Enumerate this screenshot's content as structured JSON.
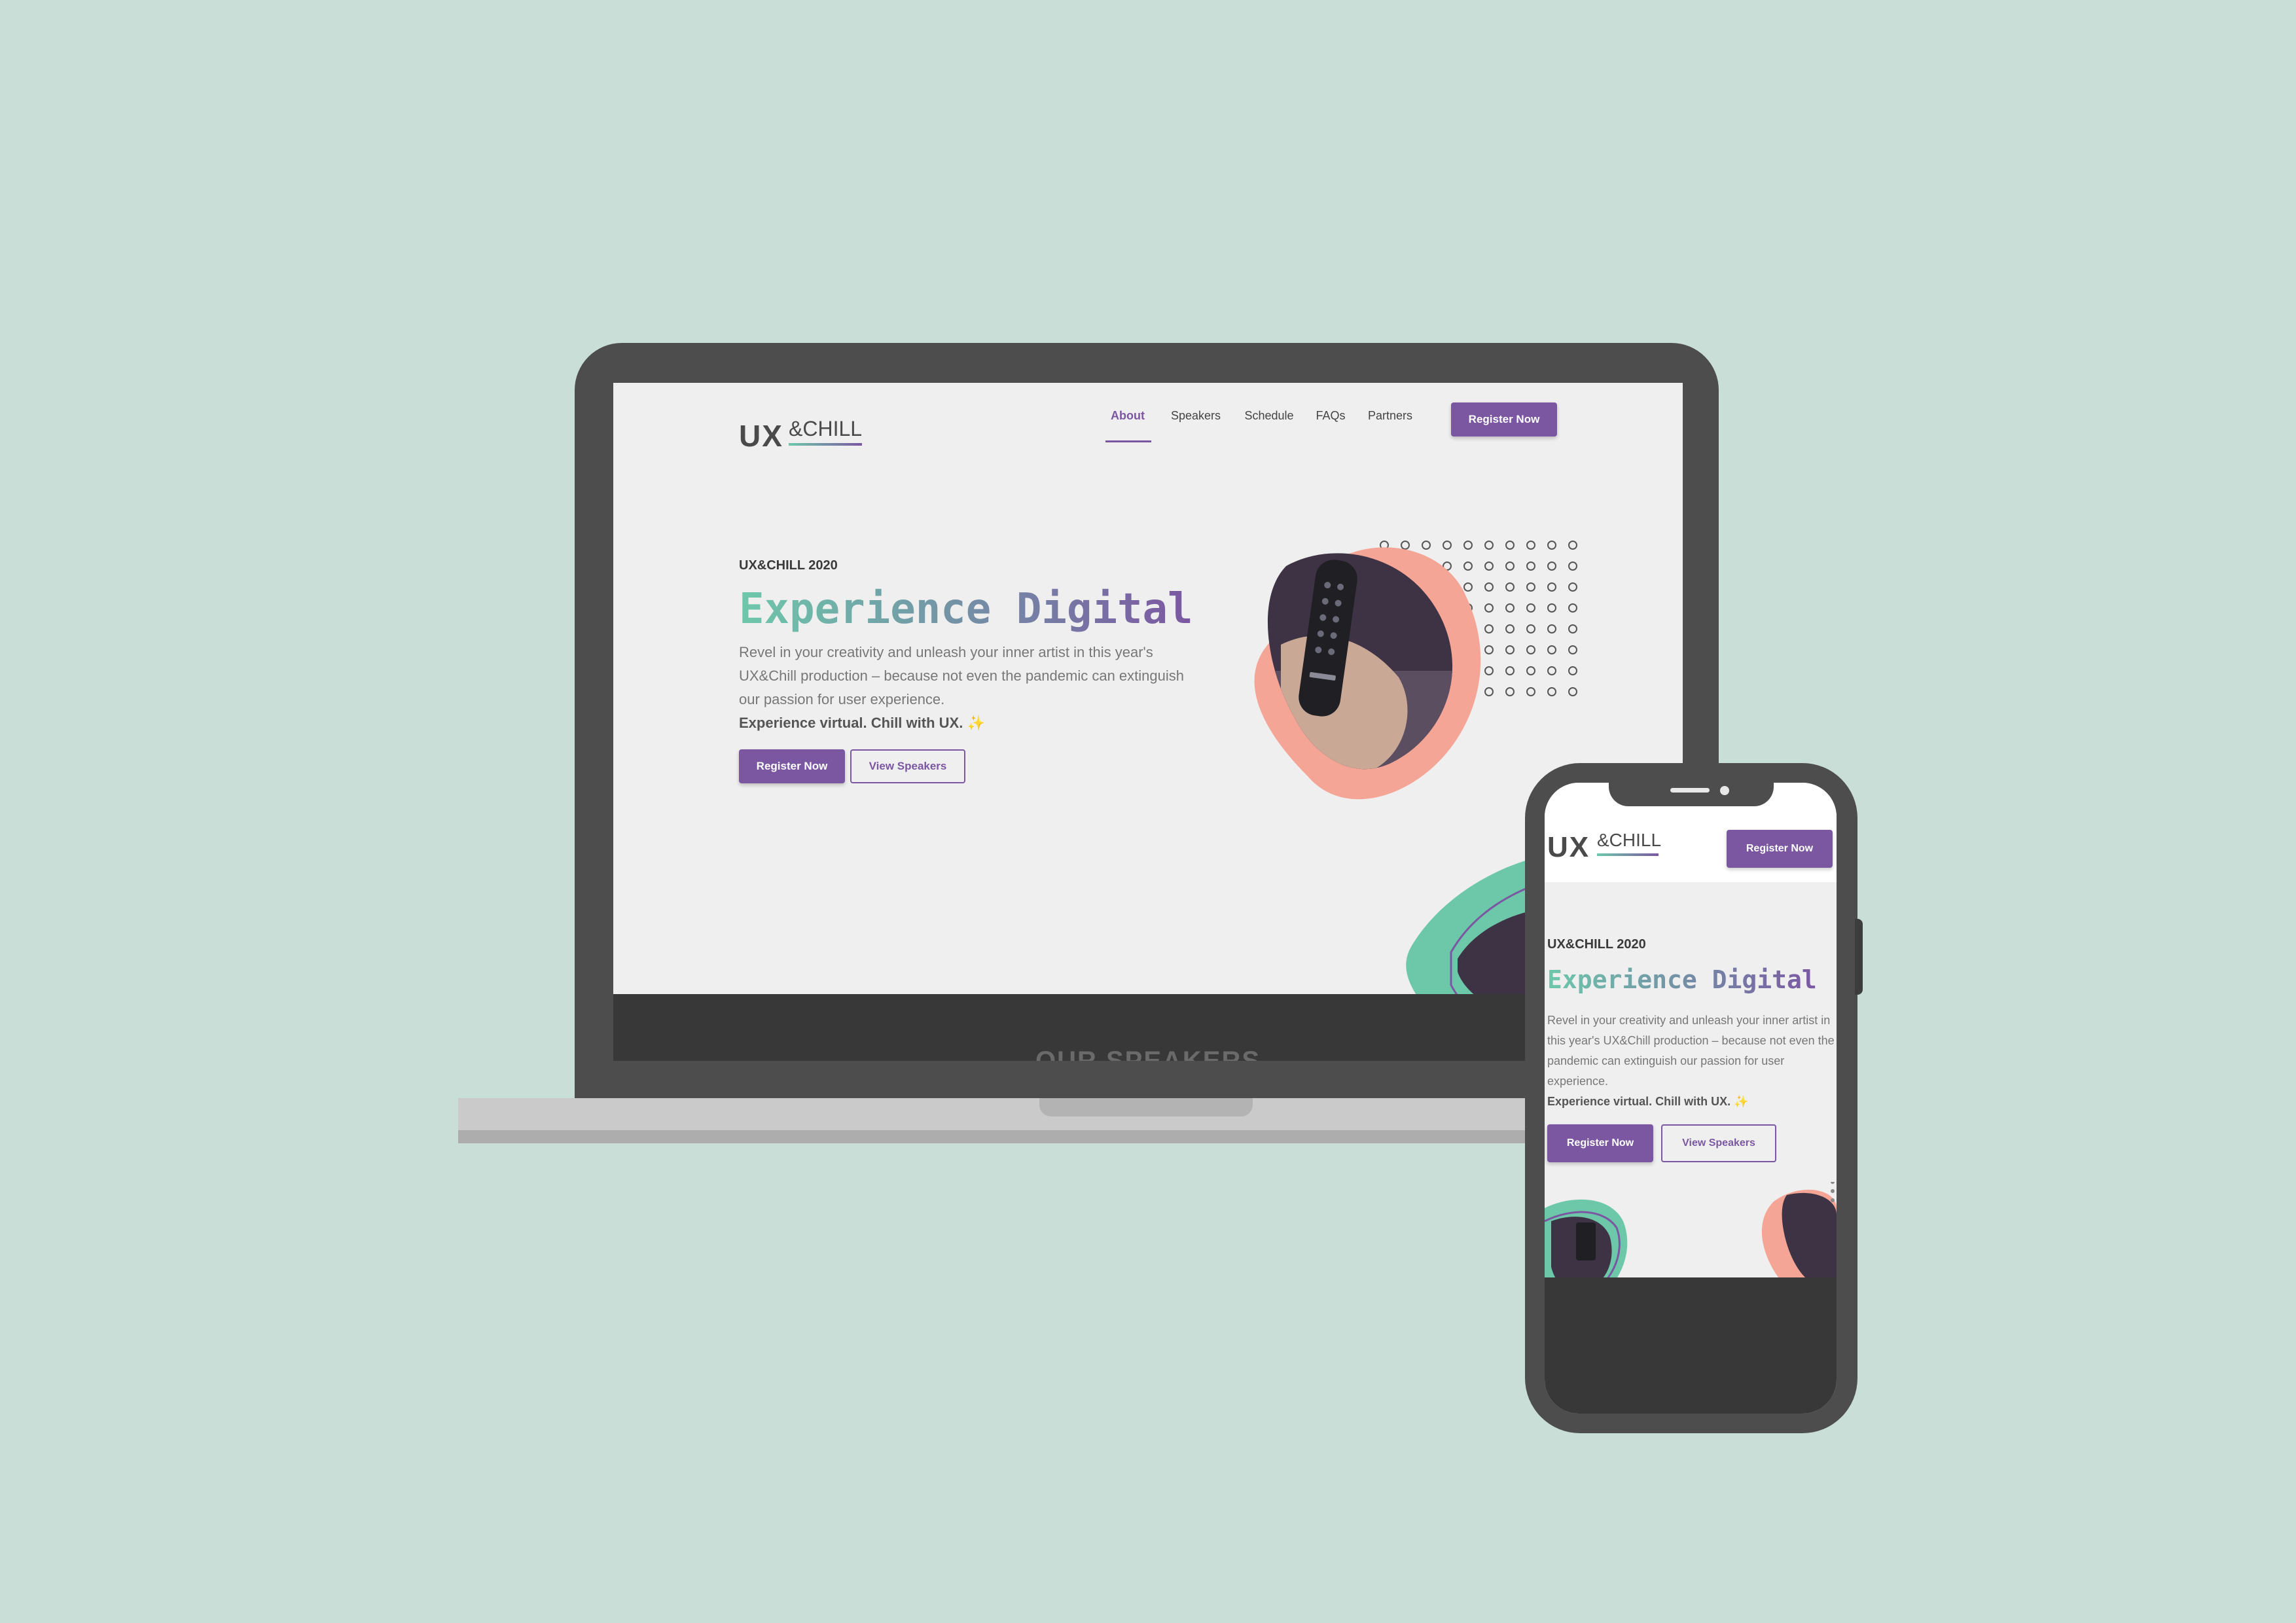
{
  "brand": {
    "ux": "UX",
    "chill": "&CHILL"
  },
  "nav": {
    "items": [
      {
        "label": "About",
        "active": true
      },
      {
        "label": "Speakers",
        "active": false
      },
      {
        "label": "Schedule",
        "active": false
      },
      {
        "label": "FAQs",
        "active": false
      },
      {
        "label": "Partners",
        "active": false
      }
    ],
    "cta": "Register Now"
  },
  "hero": {
    "eyebrow": "UX&CHILL 2020",
    "headline": "Experience Digital",
    "body_desktop": "Revel in your creativity and unleash your inner artist in this year's UX&Chill production – because not even the pandemic can extinguish our passion for user experience.",
    "body_mobile": "Revel in your creativity and unleash your inner artist in this year's UX&Chill production – because not even the pandemic can extinguish our passion for user experience.",
    "tagline": "Experience virtual. Chill with UX.",
    "sparkle": "✨",
    "primary_button": "Register Now",
    "secondary_button": "View Speakers"
  },
  "speakers_section": {
    "title": "OUR SPEAKERS"
  },
  "colors": {
    "background": "#c8ded7",
    "accent_purple": "#7b57a2",
    "accent_green": "#6dc8aa",
    "accent_coral": "#f5a596",
    "device_frame": "#4d4d4d",
    "dark_section": "#383838"
  }
}
